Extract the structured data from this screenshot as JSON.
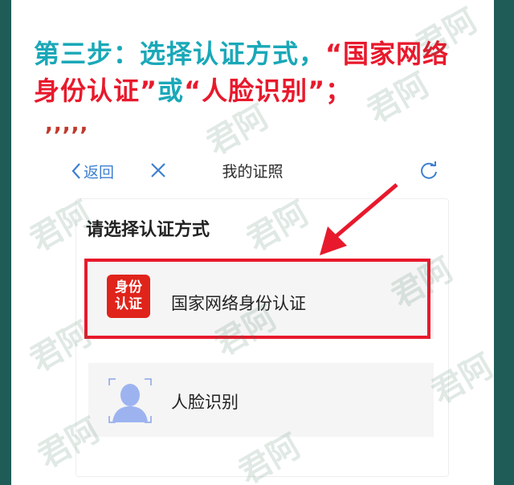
{
  "heading": {
    "line1_part1": "第三步：选择认证方式，",
    "line1_part2": "“国家网络",
    "line2_part1": "身份认证”",
    "line2_part2": "或",
    "line2_part3": "“人脸识别”；",
    "color_teal": "#1aa8b8",
    "color_red": "#e8192c"
  },
  "dashes": ",,,,,",
  "navbar": {
    "back_label": "返回",
    "title": "我的证照",
    "accent": "#3d7fd0"
  },
  "section_title": "请选择认证方式",
  "options": [
    {
      "label": "国家网络身份认证",
      "icon_text_top": "身份",
      "icon_text_bottom": "认证",
      "icon": "id-auth-icon",
      "highlighted": true
    },
    {
      "label": "人脸识别",
      "icon": "face-recognition-icon",
      "highlighted": false
    }
  ],
  "watermark_text": "君阿"
}
